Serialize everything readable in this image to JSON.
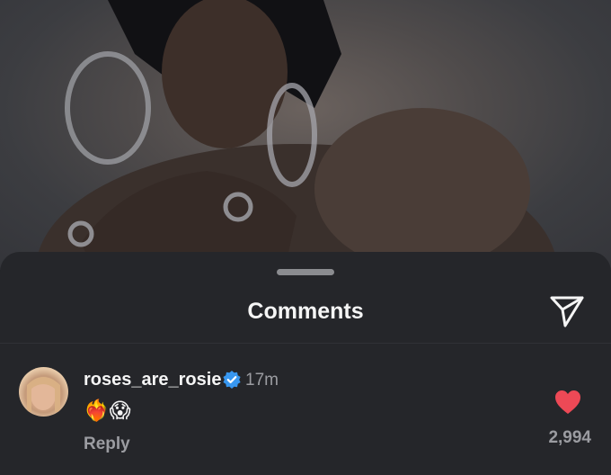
{
  "header": {
    "title": "Comments"
  },
  "icons": {
    "send": "send-icon",
    "heart": "heart-icon",
    "verified": "verified-badge-icon"
  },
  "comment": {
    "username": "roses_are_rosie",
    "time": "17m",
    "text": "❤️‍🔥😱",
    "reply_label": "Reply",
    "likes": "2,994"
  },
  "colors": {
    "heart": "#ed4956",
    "verified": "#3897f0",
    "sheet": "#25262a"
  }
}
